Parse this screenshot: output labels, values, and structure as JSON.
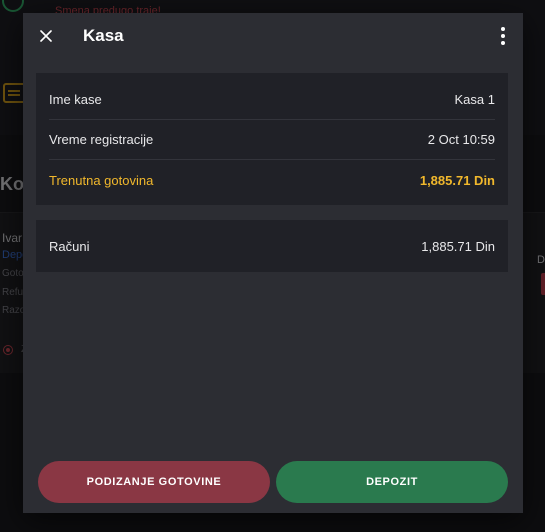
{
  "background": {
    "warning": "Smena predugo traje!",
    "section_title": "Koris",
    "user_name": "Ivar",
    "user_link": "Depo",
    "lines": [
      "Goto",
      "Refu",
      "Razo"
    ],
    "right_label": "D",
    "radio_label": "Z"
  },
  "dialog": {
    "title": "Kasa",
    "info_rows": [
      {
        "label": "Ime kase",
        "value": "Kasa 1"
      },
      {
        "label": "Vreme registracije",
        "value": "2 Oct 10:59"
      },
      {
        "label": "Trenutna gotovina",
        "value": "1,885.71 Din"
      }
    ],
    "receipts": {
      "label": "Računi",
      "value": "1,885.71 Din"
    },
    "buttons": {
      "withdraw": "PODIZANJE GOTOVINE",
      "deposit": "DEPOZIT"
    }
  },
  "colors": {
    "accent": "#f1b82c",
    "withdraw": "#8a3744",
    "deposit": "#2a7a4e"
  },
  "icons": [
    "close-icon",
    "more-vert-icon",
    "check-circle-icon",
    "cash-register-icon"
  ]
}
